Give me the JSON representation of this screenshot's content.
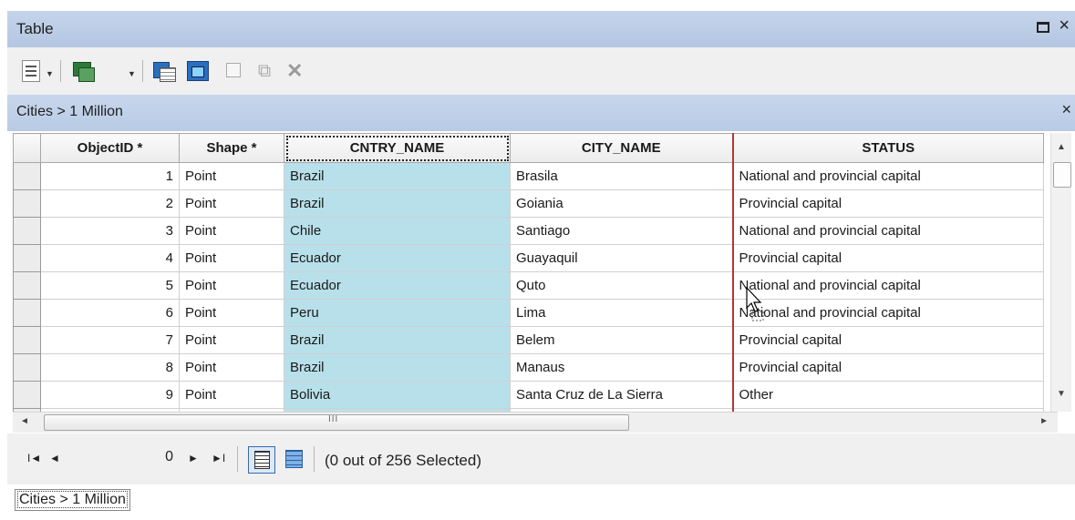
{
  "window": {
    "title": "Table",
    "restore_glyph": "□",
    "close_glyph": "×"
  },
  "toolbar": {
    "icons": [
      "table-options-icon",
      "related-tables-icon",
      "select-by-attributes-icon",
      "switch-selection-icon",
      "clear-selection-icon",
      "zoom-to-selected-icon",
      "delete-selected-icon"
    ],
    "dropdown_glyph": "▼",
    "delete_glyph": "✕"
  },
  "tab": {
    "title": "Cities > 1 Million",
    "close_glyph": "×"
  },
  "grid": {
    "columns": [
      "ObjectID *",
      "Shape *",
      "CNTRY_NAME",
      "CITY_NAME",
      "STATUS"
    ],
    "rows": [
      {
        "id": "1",
        "shape": "Point",
        "country": "Brazil",
        "city": "Brasila",
        "status": "National and provincial capital"
      },
      {
        "id": "2",
        "shape": "Point",
        "country": "Brazil",
        "city": "Goiania",
        "status": "Provincial capital"
      },
      {
        "id": "3",
        "shape": "Point",
        "country": "Chile",
        "city": "Santiago",
        "status": "National and provincial capital"
      },
      {
        "id": "4",
        "shape": "Point",
        "country": "Ecuador",
        "city": "Guayaquil",
        "status": "Provincial capital"
      },
      {
        "id": "5",
        "shape": "Point",
        "country": "Ecuador",
        "city": "Quto",
        "status": "National and provincial capital"
      },
      {
        "id": "6",
        "shape": "Point",
        "country": "Peru",
        "city": "Lima",
        "status": "National and provincial capital"
      },
      {
        "id": "7",
        "shape": "Point",
        "country": "Brazil",
        "city": "Belem",
        "status": "Provincial capital"
      },
      {
        "id": "8",
        "shape": "Point",
        "country": "Brazil",
        "city": "Manaus",
        "status": "Provincial capital"
      },
      {
        "id": "9",
        "shape": "Point",
        "country": "Bolivia",
        "city": "Santa Cruz de La Sierra",
        "status": "Other"
      }
    ],
    "highlighted_column_color": "#b8e0ea",
    "column_resize_line_color": "#b33636"
  },
  "scrollbars": {
    "up": "▲",
    "down": "▼",
    "left": "◄",
    "right": "►",
    "grip": "III"
  },
  "navigation": {
    "first": "I◄",
    "prev": "◄",
    "current_record": "0",
    "next": "►",
    "last": "►I",
    "status": "(0 out of 256 Selected)"
  },
  "bottom_tab": {
    "label": "Cities > 1 Million"
  }
}
